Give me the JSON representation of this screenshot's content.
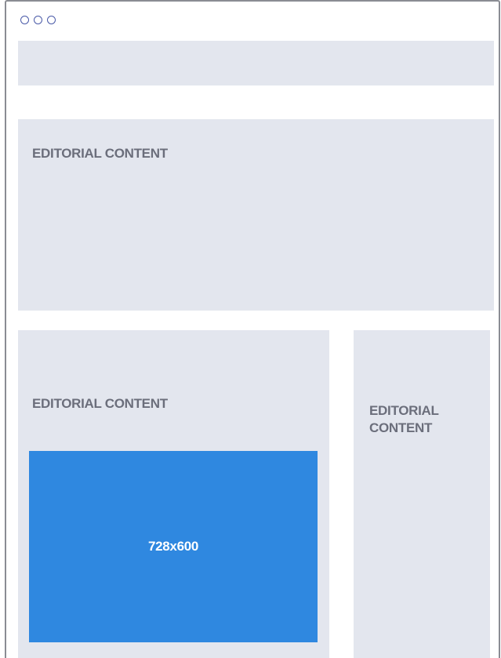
{
  "window": {
    "controls": [
      "dot-icon",
      "dot-icon",
      "dot-icon"
    ]
  },
  "header": {
    "label": ""
  },
  "hero": {
    "label": "EDITORIAL CONTENT"
  },
  "main": {
    "label": "EDITORIAL CONTENT",
    "ad_label": "728x600"
  },
  "sidebar": {
    "label": "EDITORIAL CONTENT"
  },
  "colors": {
    "frame_border": "#8a8c93",
    "placeholder_bg": "#e3e6ee",
    "label_text": "#6b6e7b",
    "ad_bg": "#2f88e0",
    "ad_text": "#ffffff",
    "dot_outline": "#4a5aa8"
  }
}
